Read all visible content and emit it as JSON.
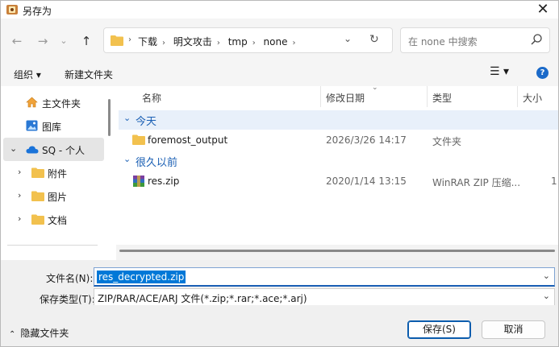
{
  "window": {
    "title": "另存为",
    "close_glyph": "✕"
  },
  "nav": {
    "back_icon": "arrow-left-icon",
    "forward_icon": "arrow-right-icon",
    "recent_icon": "chevron-down-icon",
    "up_icon": "arrow-up-icon",
    "breadcrumb": [
      "下载",
      "明文攻击",
      "tmp",
      "none"
    ],
    "search_placeholder": "在 none 中搜索"
  },
  "toolbar": {
    "organize_label": "组织 ▾",
    "new_folder_label": "新建文件夹",
    "view_label": "☰ ▾",
    "help_label": "?"
  },
  "sidebar": {
    "items": [
      {
        "label": "主文件夹",
        "icon": "home-icon"
      },
      {
        "label": "图库",
        "icon": "gallery-icon"
      },
      {
        "label": "SQ - 个人",
        "icon": "cloud-icon",
        "selected": true
      },
      {
        "label": "附件",
        "icon": "folder-icon"
      },
      {
        "label": "图片",
        "icon": "folder-icon"
      },
      {
        "label": "文档",
        "icon": "folder-icon"
      }
    ]
  },
  "list": {
    "columns": [
      "名称",
      "修改日期",
      "类型",
      "大小"
    ],
    "groups": [
      {
        "label": "今天",
        "files": [
          {
            "name": "foremost_output",
            "date": "2026/3/26 14:17",
            "type": "文件夹",
            "size": ""
          }
        ]
      },
      {
        "label": "很久以前",
        "files": [
          {
            "name": "res.zip",
            "date": "2020/1/14 13:15",
            "type": "WinRAR ZIP 压缩...",
            "size": "1"
          }
        ]
      }
    ]
  },
  "fields": {
    "filename_label": "文件名(N):",
    "filename_value": "res_decrypted.zip",
    "filetype_label": "保存类型(T):",
    "filetype_value": "ZIP/RAR/ACE/ARJ 文件(*.zip;*.rar;*.ace;*.arj)"
  },
  "bottom": {
    "hide_folders_label": "隐藏文件夹",
    "save_label": "保存(S)",
    "cancel_label": "取消"
  },
  "colors": {
    "accent": "#0078d7",
    "group_text": "#1a5fb4",
    "folder": "#f2c14e"
  }
}
